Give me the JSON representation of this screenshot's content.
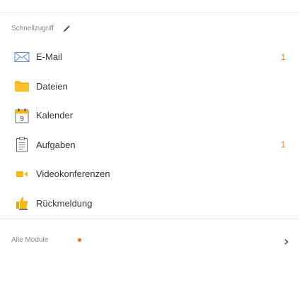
{
  "quick_access": {
    "title": "Schnellzugriff",
    "edit_icon": "pencil-icon",
    "items": [
      {
        "label": "E-Mail",
        "icon": "envelope-icon",
        "badge": "1"
      },
      {
        "label": "Dateien",
        "icon": "folder-icon",
        "badge": ""
      },
      {
        "label": "Kalender",
        "icon": "calendar-icon",
        "badge": "",
        "icon_text": "9"
      },
      {
        "label": "Aufgaben",
        "icon": "clipboard-icon",
        "badge": "1"
      },
      {
        "label": "Videokonferenzen",
        "icon": "video-camera-icon",
        "badge": ""
      },
      {
        "label": "Rückmeldung",
        "icon": "thumbs-up-icon",
        "badge": ""
      }
    ]
  },
  "footer": {
    "all_modules_label": "Alle Module",
    "indicator": "orange-dot",
    "chevron": "chevron-right-icon"
  },
  "colors": {
    "accent_orange": "#e8720c",
    "folder_yellow": "#f5b915",
    "text_muted": "#8a8a8a"
  }
}
